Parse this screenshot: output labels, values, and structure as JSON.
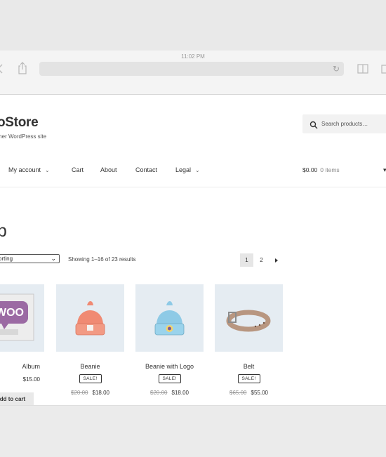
{
  "browser": {
    "time": "11:02 PM"
  },
  "site": {
    "title": "oStore",
    "description": "ther WordPress site"
  },
  "search": {
    "placeholder": "Search products…"
  },
  "nav": {
    "items": [
      {
        "label": "My account",
        "has_dropdown": true
      },
      {
        "label": "Cart",
        "has_dropdown": false
      },
      {
        "label": "About",
        "has_dropdown": false
      },
      {
        "label": "Contact",
        "has_dropdown": false
      },
      {
        "label": "Legal",
        "has_dropdown": true
      }
    ],
    "cart_total": "$0.00",
    "cart_items": "0 items"
  },
  "shop": {
    "title": "op",
    "sort_label": "sorting",
    "result_count": "Showing 1–16 of 23 results",
    "pagination": [
      "1",
      "2"
    ]
  },
  "products": [
    {
      "name": "Album",
      "price": "$15.00",
      "sale": false,
      "add_to_cart": "dd to cart"
    },
    {
      "name": "Beanie",
      "sale_label": "SALE!",
      "old_price": "$20.00",
      "price": "$18.00",
      "sale": true
    },
    {
      "name": "Beanie with Logo",
      "sale_label": "SALE!",
      "old_price": "$20.00",
      "price": "$18.00",
      "sale": true
    },
    {
      "name": "Belt",
      "sale_label": "SALE!",
      "old_price": "$65.00",
      "price": "$55.00",
      "sale": true
    }
  ],
  "colors": {
    "thumb_bg": "#e5ecf2",
    "beanie": "#f08a73",
    "beanie_logo": "#8ecae6",
    "belt": "#b89680",
    "woo_purple": "#9b6aa3"
  }
}
